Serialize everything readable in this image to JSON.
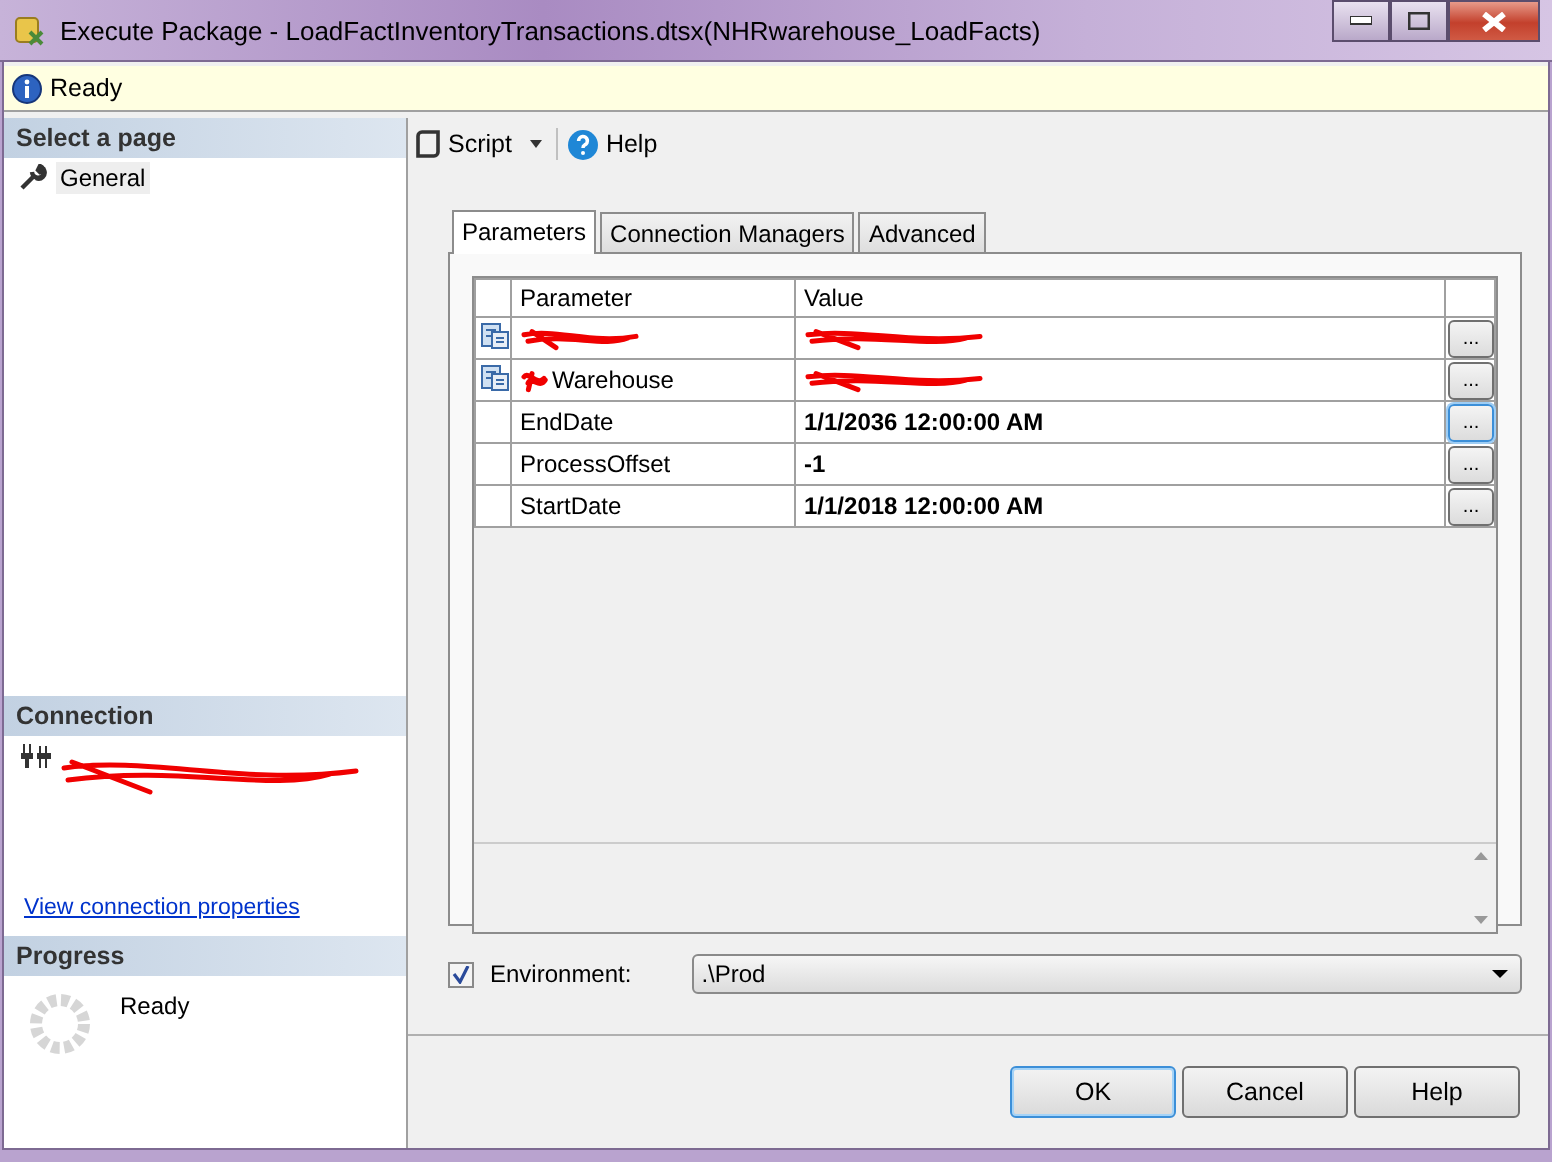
{
  "window": {
    "title": "Execute Package - LoadFactInventoryTransactions.dtsx(NHRwarehouse_LoadFacts)"
  },
  "status": {
    "text": "Ready"
  },
  "sidebar": {
    "header": "Select a page",
    "items": [
      {
        "label": "General",
        "selected": true
      }
    ]
  },
  "connection": {
    "header": "Connection",
    "redacted": true,
    "link": "View connection properties"
  },
  "progress": {
    "header": "Progress",
    "text": "Ready"
  },
  "toolbar": {
    "items": [
      {
        "kind": "script",
        "label": "Script"
      },
      {
        "kind": "help",
        "label": "Help"
      }
    ]
  },
  "tabs": [
    {
      "label": "Parameters",
      "selected": true
    },
    {
      "label": "Connection Managers",
      "selected": false
    },
    {
      "label": "Advanced",
      "selected": false
    }
  ],
  "table": {
    "columns": [
      "Parameter",
      "Value"
    ],
    "rows": [
      {
        "kind": "connection",
        "redacted": true,
        "focused": false
      },
      {
        "kind": "connection",
        "redacted": true,
        "parameter": "Warehouse",
        "focused": false
      },
      {
        "kind": "plain",
        "redacted": false,
        "parameter": "EndDate",
        "value": "1/1/2036 12:00:00 AM",
        "focused": true
      },
      {
        "kind": "plain",
        "redacted": false,
        "parameter": "ProcessOffset",
        "value": "-1",
        "focused": false
      },
      {
        "kind": "plain",
        "redacted": false,
        "parameter": "StartDate",
        "value": "1/1/2018 12:00:00 AM",
        "focused": false
      }
    ],
    "button": "..."
  },
  "environment": {
    "label": "Environment:",
    "checked": true,
    "value": ".\\Prod"
  },
  "buttons": [
    {
      "label": "OK",
      "default": true
    },
    {
      "label": "Cancel",
      "default": false
    },
    {
      "label": "Help",
      "default": false
    }
  ]
}
